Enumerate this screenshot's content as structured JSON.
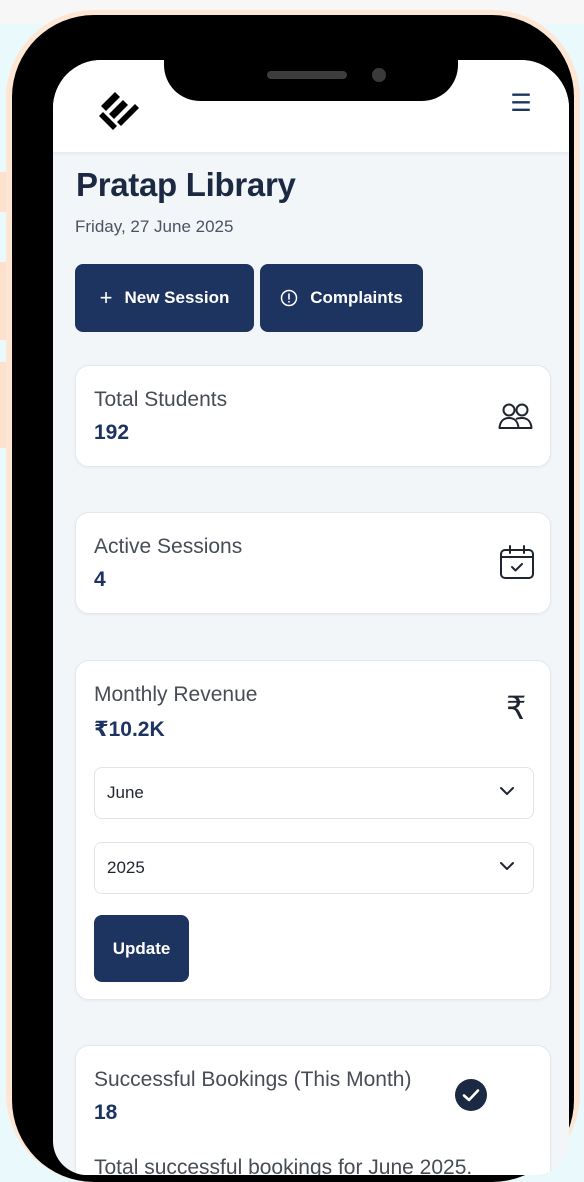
{
  "app": {
    "title": "Pratap Library",
    "date": "Friday, 27 June 2025"
  },
  "header": {
    "logo_icon": "diamond-chevron-logo-icon",
    "menu_icon": "hamburger-menu-icon",
    "menu_glyph": "☰"
  },
  "actions": {
    "new_session_icon": "plus",
    "new_session_glyph": "+",
    "new_session_label": "New Session",
    "complaints_icon": "alert-circle-icon",
    "complaints_label": "Complaints"
  },
  "stats": {
    "total_students": {
      "label": "Total Students",
      "value": "192",
      "icon": "users-icon"
    },
    "active_sessions": {
      "label": "Active Sessions",
      "value": "4",
      "icon": "calendar-check-icon"
    },
    "monthly_revenue": {
      "label": "Monthly Revenue",
      "value": "₹10.2K",
      "icon": "rupee-icon",
      "icon_glyph": "₹",
      "month": "June",
      "year": "2025",
      "update_label": "Update"
    },
    "successful_bookings": {
      "label": "Successful Bookings (This Month)",
      "value": "18",
      "icon": "check-circle-icon",
      "description": "Total successful bookings for June 2025."
    }
  },
  "colors": {
    "primary": "#1d3461",
    "text_dark": "#1c2942",
    "text_muted": "#474c56",
    "screen_bg": "#f3f6f9",
    "outline": "#fde6d4"
  }
}
